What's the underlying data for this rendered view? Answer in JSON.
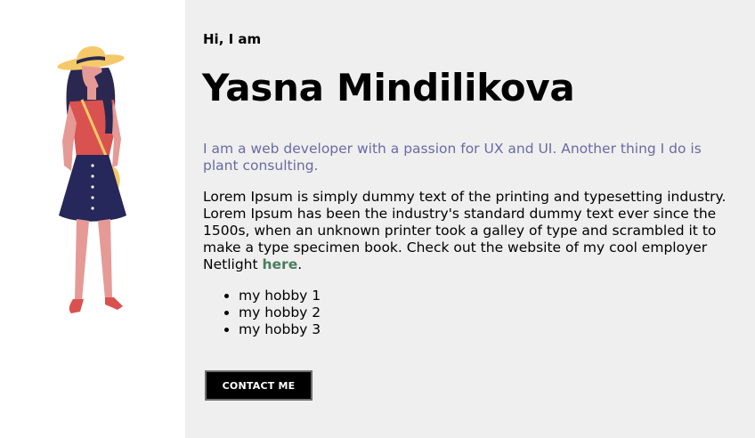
{
  "hero": {
    "greeting": "Hi, I am",
    "name": "Yasna Mindilikova",
    "tagline": "I am a web developer with a passion for UX and UI. Another thing I do is plant consulting.",
    "bio_text": "Lorem Ipsum is simply dummy text of the printing and typesetting industry. Lorem Ipsum has been the industry's standard dummy text ever since the 1500s, when an unknown printer took a galley of type and scrambled it to make a type specimen book. Check out the website of my cool employer Netlight ",
    "bio_link": "here",
    "bio_end": ".",
    "hobbies": [
      "my hobby 1",
      "my hobby 2",
      "my hobby 3"
    ],
    "contact_label": "CONTACT ME"
  },
  "colors": {
    "panel_bg": "#efefef",
    "tagline": "#6a6aa3",
    "link": "#4a7d5c",
    "button_bg": "#000000"
  },
  "illustration": {
    "icon": "woman-with-sun-hat-illustration"
  }
}
